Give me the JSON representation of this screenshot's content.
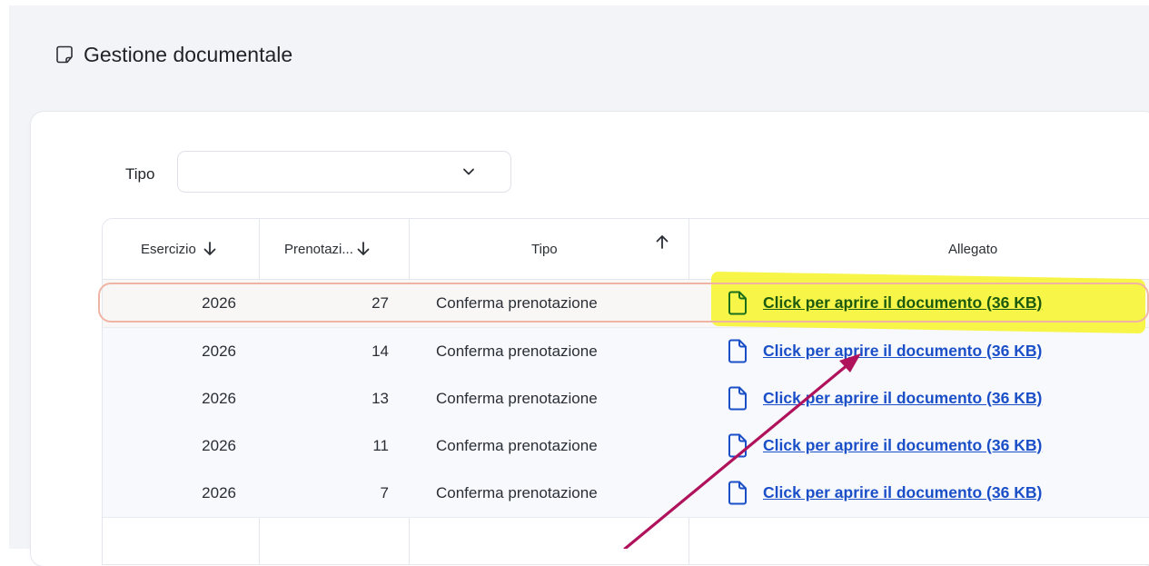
{
  "page": {
    "title": "Gestione documentale",
    "title_icon": "document-icon"
  },
  "filter": {
    "label": "Tipo",
    "selected_value": ""
  },
  "table": {
    "columns": [
      {
        "label": "Esercizio",
        "sort": "desc"
      },
      {
        "label": "Prenotazi...",
        "sort": "desc"
      },
      {
        "label": "Tipo",
        "sort": "asc"
      },
      {
        "label": "Allegato",
        "sort": ""
      }
    ],
    "rows": [
      {
        "esercizio": "2026",
        "prenotazione": "27",
        "tipo": "Conferma prenotazione",
        "allegato": "Click per aprire il documento (36 KB)",
        "selected": true
      },
      {
        "esercizio": "2026",
        "prenotazione": "14",
        "tipo": "Conferma prenotazione",
        "allegato": "Click per aprire il documento (36 KB)",
        "selected": false
      },
      {
        "esercizio": "2026",
        "prenotazione": "13",
        "tipo": "Conferma prenotazione",
        "allegato": "Click per aprire il documento (36 KB)",
        "selected": false
      },
      {
        "esercizio": "2026",
        "prenotazione": "11",
        "tipo": "Conferma prenotazione",
        "allegato": "Click per aprire il documento (36 KB)",
        "selected": false
      },
      {
        "esercizio": "2026",
        "prenotazione": "7",
        "tipo": "Conferma prenotazione",
        "allegato": "Click per aprire il documento (36 KB)",
        "selected": false
      }
    ]
  },
  "colors": {
    "link": "#1b4fc8",
    "highlight": "#f7f43a",
    "annotation_arrow": "#b0125b",
    "selected_outline": "#f0b4a4"
  }
}
